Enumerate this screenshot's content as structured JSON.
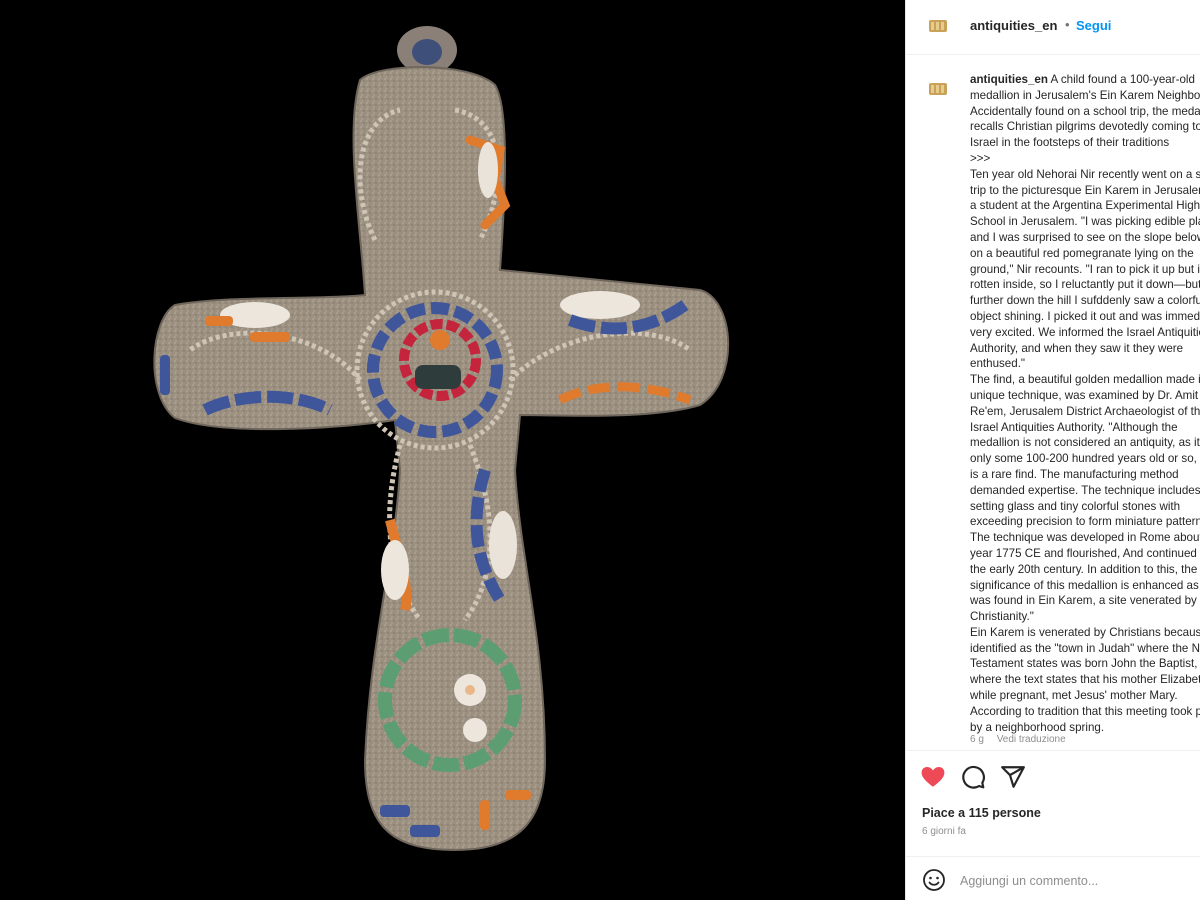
{
  "post": {
    "username": "antiquities_en",
    "dot": "•",
    "follow_label": "Segui",
    "caption_text": "A child found a 100-year-old medallion in Jerusalem's Ein Karem Neighborhood\nAccidentally found on a school trip, the medallion recalls Christian pilgrims devotedly coming to visit Israel in the footsteps of their traditions\n>>>\nTen year old Nehorai Nir recently went on a school trip to the picturesque Ein Karem in Jerusalem as a student at the Argentina Experimental High School in Jerusalem. \"I was picking edible plants, and I was surprised to see on the slope below me on a beautiful red pomegranate lying on the ground,\" Nir recounts. \"I ran to pick it up but it was rotten inside, so I reluctantly put it down—but then further down the hill I sufddenly saw a colorful object shining. I picked it out and was immediately very excited. We informed the Israel Antiquities Authority, and when they saw it they were enthused.\"\nThe find, a beautiful golden medallion made in a unique technique, was examined by Dr. Amit Re'em, Jerusalem District Archaeologist of the Israel Antiquities Authority. \"Although the medallion is not considered an antiquity, as it is only some 100-200 hundred years old or so, but it is a rare find. The manufacturing method demanded expertise. The technique includes setting glass and tiny colorful stones with exceeding precision to form miniature patterns. The technique was developed in Rome about the year 1775 CE and flourished, And continued until the early 20th century. In addition to this, the significance of this medallion is enhanced as it was found in Ein Karem, a site venerated by Christianity.\"\nEin Karem is venerated by Christians because it is identified as the \"town in Judah\" where the New Testament states was born John the Baptist, and where the text states that his mother Elizabeth, while pregnant, met Jesus' mother Mary. According to tradition that this meeting took place by a neighborhood spring.\n\nPhotographer: Emil Aladjem Israel Antiquities Authority",
    "time_ago": "6 g",
    "see_translation": "Vedi traduzione",
    "likes_text": "Piace a 115 persone",
    "date_text": "6 giorni fa",
    "comment_placeholder": "Aggiungi un commento...",
    "colors": {
      "link": "#0095f6",
      "like_red": "#ed4956",
      "text": "#262626",
      "muted": "#8e8e8e"
    },
    "icons": [
      "heart-icon",
      "comment-icon",
      "share-icon",
      "emoji-icon"
    ]
  }
}
